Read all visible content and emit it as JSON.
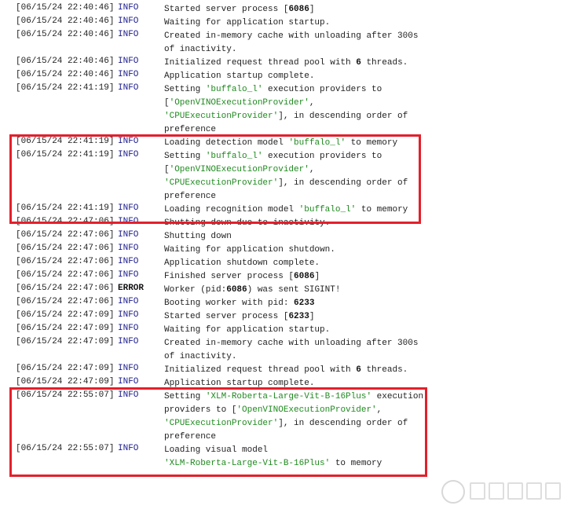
{
  "log": [
    {
      "ts": "[06/15/24 22:40:46]",
      "level": "INFO",
      "lines": [
        [
          {
            "t": "Started server process ["
          },
          {
            "t": "6086",
            "k": "num"
          },
          {
            "t": "]"
          }
        ]
      ]
    },
    {
      "ts": "[06/15/24 22:40:46]",
      "level": "INFO",
      "lines": [
        [
          {
            "t": "Waiting for application startup."
          }
        ]
      ]
    },
    {
      "ts": "[06/15/24 22:40:46]",
      "level": "INFO",
      "lines": [
        [
          {
            "t": "Created in-memory cache with unloading after 300s"
          }
        ],
        [
          {
            "t": "of inactivity."
          }
        ]
      ]
    },
    {
      "ts": "[06/15/24 22:40:46]",
      "level": "INFO",
      "lines": [
        [
          {
            "t": "Initialized request thread pool with "
          },
          {
            "t": "6",
            "k": "num"
          },
          {
            "t": " threads."
          }
        ]
      ]
    },
    {
      "ts": "[06/15/24 22:40:46]",
      "level": "INFO",
      "lines": [
        [
          {
            "t": "Application startup complete."
          }
        ]
      ]
    },
    {
      "ts": "[06/15/24 22:41:19]",
      "level": "INFO",
      "lines": [
        [
          {
            "t": "Setting "
          },
          {
            "t": "'buffalo_l'",
            "k": "str"
          },
          {
            "t": " execution providers to"
          }
        ],
        [
          {
            "t": "["
          },
          {
            "t": "'OpenVINOExecutionProvider'",
            "k": "str"
          },
          {
            "t": ","
          }
        ],
        [
          {
            "t": "'CPUExecutionProvider'",
            "k": "str"
          },
          {
            "t": "], in descending order of"
          }
        ],
        [
          {
            "t": "preference"
          }
        ]
      ]
    },
    {
      "ts": "[06/15/24 22:41:19]",
      "level": "INFO",
      "lines": [
        [
          {
            "t": "Loading detection model "
          },
          {
            "t": "'buffalo_l'",
            "k": "str"
          },
          {
            "t": " to memory"
          }
        ]
      ]
    },
    {
      "ts": "[06/15/24 22:41:19]",
      "level": "INFO",
      "lines": [
        [
          {
            "t": "Setting "
          },
          {
            "t": "'buffalo_l'",
            "k": "str"
          },
          {
            "t": " execution providers to"
          }
        ],
        [
          {
            "t": "["
          },
          {
            "t": "'OpenVINOExecutionProvider'",
            "k": "str"
          },
          {
            "t": ","
          }
        ],
        [
          {
            "t": "'CPUExecutionProvider'",
            "k": "str"
          },
          {
            "t": "], in descending order of"
          }
        ],
        [
          {
            "t": "preference"
          }
        ]
      ]
    },
    {
      "ts": "[06/15/24 22:41:19]",
      "level": "INFO",
      "lines": [
        [
          {
            "t": "Loading recognition model "
          },
          {
            "t": "'buffalo_l'",
            "k": "str"
          },
          {
            "t": " to memory"
          }
        ]
      ]
    },
    {
      "ts": "[06/15/24 22:47:06]",
      "level": "INFO",
      "lines": [
        [
          {
            "t": "Shutting down due to inactivity."
          }
        ]
      ]
    },
    {
      "ts": "[06/15/24 22:47:06]",
      "level": "INFO",
      "lines": [
        [
          {
            "t": "Shutting down"
          }
        ]
      ]
    },
    {
      "ts": "[06/15/24 22:47:06]",
      "level": "INFO",
      "lines": [
        [
          {
            "t": "Waiting for application shutdown."
          }
        ]
      ]
    },
    {
      "ts": "[06/15/24 22:47:06]",
      "level": "INFO",
      "lines": [
        [
          {
            "t": "Application shutdown complete."
          }
        ]
      ]
    },
    {
      "ts": "[06/15/24 22:47:06]",
      "level": "INFO",
      "lines": [
        [
          {
            "t": "Finished server process ["
          },
          {
            "t": "6086",
            "k": "num"
          },
          {
            "t": "]"
          }
        ]
      ]
    },
    {
      "ts": "[06/15/24 22:47:06]",
      "level": "ERROR",
      "lines": [
        [
          {
            "t": "Worker (pid:"
          },
          {
            "t": "6086",
            "k": "num"
          },
          {
            "t": ") was sent SIGINT!"
          }
        ]
      ]
    },
    {
      "ts": "[06/15/24 22:47:06]",
      "level": "INFO",
      "lines": [
        [
          {
            "t": "Booting worker with pid: "
          },
          {
            "t": "6233",
            "k": "num"
          }
        ]
      ]
    },
    {
      "ts": "[06/15/24 22:47:09]",
      "level": "INFO",
      "lines": [
        [
          {
            "t": "Started server process ["
          },
          {
            "t": "6233",
            "k": "num"
          },
          {
            "t": "]"
          }
        ]
      ]
    },
    {
      "ts": "[06/15/24 22:47:09]",
      "level": "INFO",
      "lines": [
        [
          {
            "t": "Waiting for application startup."
          }
        ]
      ]
    },
    {
      "ts": "[06/15/24 22:47:09]",
      "level": "INFO",
      "lines": [
        [
          {
            "t": "Created in-memory cache with unloading after 300s"
          }
        ],
        [
          {
            "t": "of inactivity."
          }
        ]
      ]
    },
    {
      "ts": "[06/15/24 22:47:09]",
      "level": "INFO",
      "lines": [
        [
          {
            "t": "Initialized request thread pool with "
          },
          {
            "t": "6",
            "k": "num"
          },
          {
            "t": " threads."
          }
        ]
      ]
    },
    {
      "ts": "[06/15/24 22:47:09]",
      "level": "INFO",
      "lines": [
        [
          {
            "t": "Application startup complete."
          }
        ]
      ]
    },
    {
      "ts": "[06/15/24 22:55:07]",
      "level": "INFO",
      "lines": [
        [
          {
            "t": "Setting "
          },
          {
            "t": "'XLM-Roberta-Large-Vit-B-16Plus'",
            "k": "str"
          },
          {
            "t": " execution"
          }
        ],
        [
          {
            "t": "providers to ["
          },
          {
            "t": "'OpenVINOExecutionProvider'",
            "k": "str"
          },
          {
            "t": ","
          }
        ],
        [
          {
            "t": "'CPUExecutionProvider'",
            "k": "str"
          },
          {
            "t": "], in descending order of"
          }
        ],
        [
          {
            "t": "preference"
          }
        ]
      ]
    },
    {
      "ts": "[06/15/24 22:55:07]",
      "level": "INFO",
      "lines": [
        [
          {
            "t": "Loading visual model"
          }
        ],
        [
          {
            "t": "'XLM-Roberta-Large-Vit-B-16Plus'",
            "k": "str"
          },
          {
            "t": " to memory"
          }
        ]
      ]
    }
  ],
  "watermark": {
    "text": "值 什么值得买"
  },
  "colors": {
    "highlight_box": "#e3202b",
    "info": "#1a1a8c",
    "string": "#1f8a1f"
  }
}
